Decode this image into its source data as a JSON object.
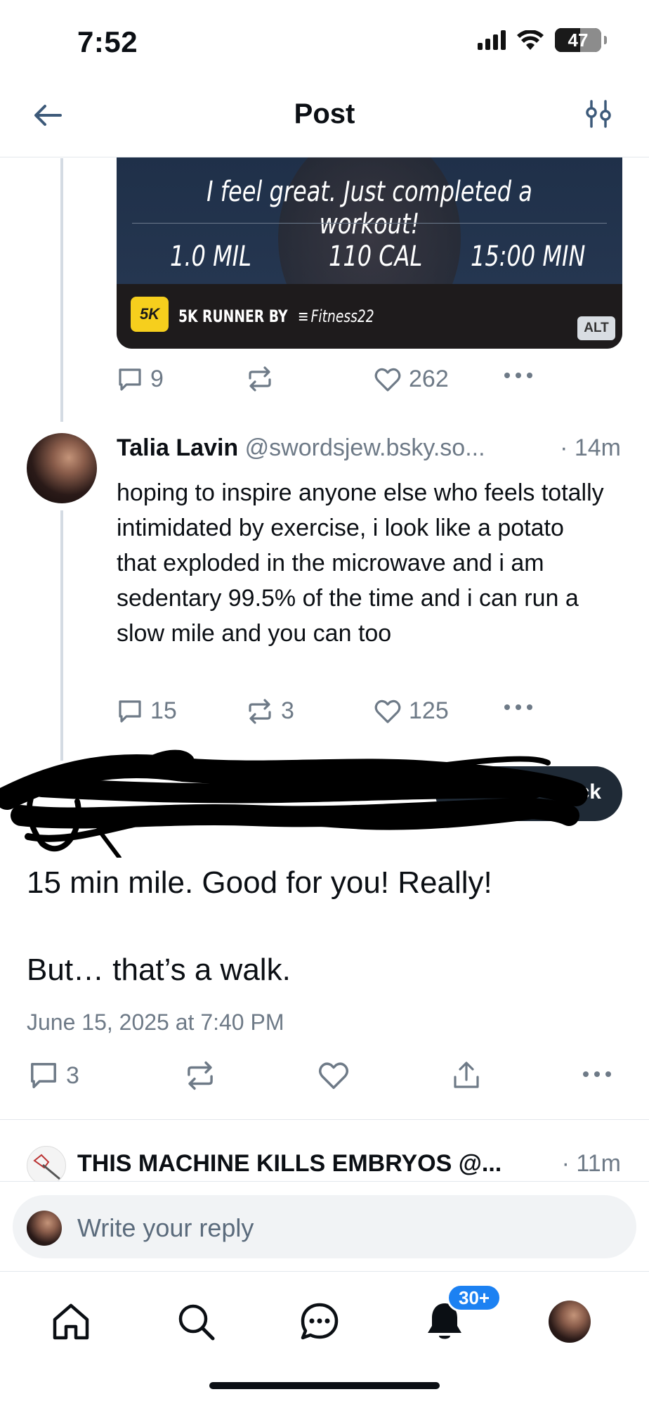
{
  "status_bar": {
    "time": "7:52",
    "battery": "47",
    "icons": [
      "signal-icon",
      "wifi-icon",
      "battery-icon"
    ]
  },
  "header": {
    "title": "Post",
    "back_icon": "arrow-left-icon",
    "filter_icon": "sliders-icon"
  },
  "parent_post": {
    "image": {
      "message": "I feel great. Just completed a workout!",
      "stats": [
        "1.0 MIL",
        "110 CAL",
        "15:00 MIN"
      ],
      "logo": "5K",
      "app_label": "5K RUNNER BY",
      "brand": "Fitness22",
      "alt_badge": "ALT"
    },
    "actions": {
      "replies": "9",
      "reposts": "",
      "likes": "262"
    }
  },
  "reply_post": {
    "author_name": "Talia Lavin",
    "author_handle": "@swordsjew.bsky.so...",
    "time": "· 14m",
    "text": "hoping to inspire anyone else who feels totally intimidated by exercise, i look like a potato that exploded in the microwave and i am sedentary 99.5% of the time and i can run a slow mile and you can too",
    "actions": {
      "replies": "15",
      "reposts": "3",
      "likes": "125"
    }
  },
  "main_post": {
    "follow_button_fragment": "ack",
    "text_line1": "15 min mile. Good for you! Really!",
    "text_line2": "But… that’s a walk.",
    "timestamp": "June 15, 2025 at 7:40 PM",
    "actions": {
      "replies": "3"
    }
  },
  "next_post": {
    "author": "THIS MACHINE KILLS EMBRYOS @...",
    "time": "· 11m"
  },
  "reply_box": {
    "placeholder": "Write your reply"
  },
  "bottom_nav": {
    "items": [
      "home-icon",
      "search-icon",
      "chat-icon",
      "bell-icon",
      "profile-avatar"
    ],
    "notification_badge": "30+"
  },
  "colors": {
    "text": "#0b0f14",
    "muted": "#6e7a87",
    "accent": "#1c81f2",
    "divider": "#e3e7ec"
  }
}
